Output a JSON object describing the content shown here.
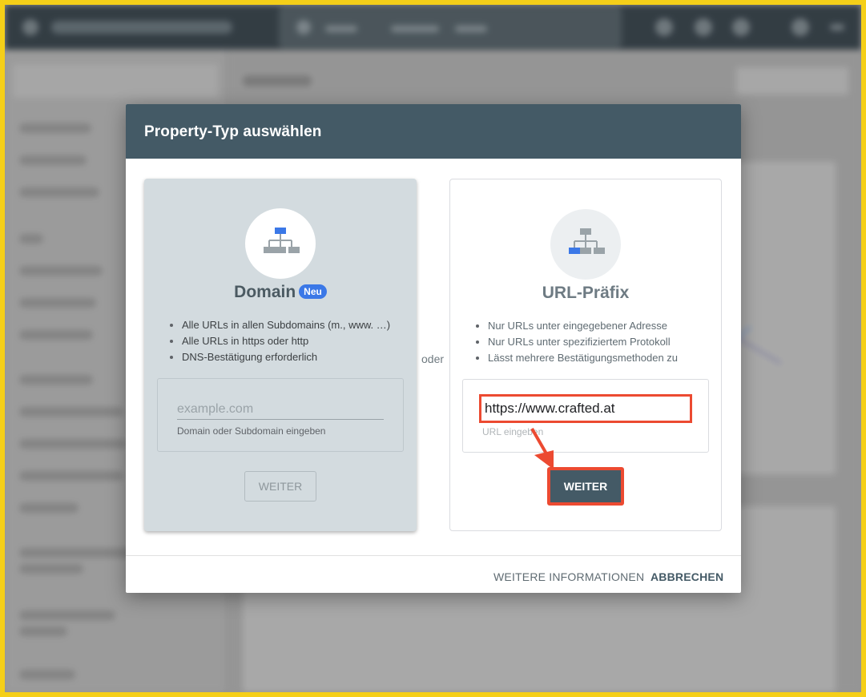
{
  "modal": {
    "title": "Property-Typ auswählen",
    "separator": "oder",
    "domain": {
      "title": "Domain",
      "badge": "Neu",
      "bullets": [
        "Alle URLs in allen Subdomains (m., www. …)",
        "Alle URLs in https oder http",
        "DNS-Bestätigung erforderlich"
      ],
      "input_value": "",
      "input_placeholder": "example.com",
      "input_hint": "Domain oder Subdomain eingeben",
      "button": "WEITER"
    },
    "url_prefix": {
      "title": "URL-Präfix",
      "bullets": [
        "Nur URLs unter eingegebener Adresse",
        "Nur URLs unter spezifiziertem Protokoll",
        "Lässt mehrere Bestätigungsmethoden zu"
      ],
      "input_value": "https://www.crafted.at",
      "input_hint": "URL eingeben",
      "button": "WEITER"
    },
    "footer": {
      "more_info": "WEITERE INFORMATIONEN",
      "cancel": "ABBRECHEN"
    }
  },
  "colors": {
    "frame_border": "#f5cf18",
    "header_bg": "#445a66",
    "accent_blue": "#3b78e7",
    "highlight_red": "#ec4a31"
  }
}
